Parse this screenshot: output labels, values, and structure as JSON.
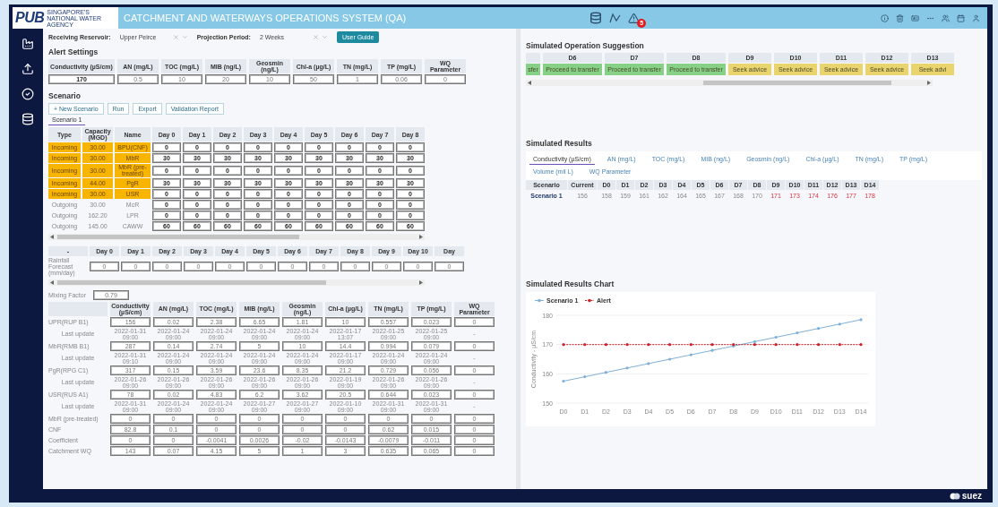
{
  "header": {
    "logo": "PUB",
    "logo_tagline": "SINGAPORE'S NATIONAL WATER AGENCY",
    "title": "CATCHMENT AND WATERWAYS OPERATIONS SYSTEM (QA)",
    "alert_badge": "5"
  },
  "filters": {
    "reservoir_label": "Receiving Reservoir:",
    "reservoir": "Upper Peirce",
    "period_label": "Projection Period:",
    "period": "2 Weeks",
    "guide_button": "User Guide"
  },
  "alert_settings": {
    "title": "Alert Settings",
    "columns": [
      "Conductivity (µS/cm)",
      "AN (mg/L)",
      "TOC (mg/L)",
      "MIB (ng/L)",
      "Geosmin (ng/L)",
      "Chl-a (µg/L)",
      "TN (mg/L)",
      "TP (mg/L)",
      "WQ Parameter"
    ],
    "values": [
      {
        "value": "170",
        "disabled": false
      },
      {
        "value": "0.5",
        "disabled": true
      },
      {
        "value": "10",
        "disabled": true
      },
      {
        "value": "20",
        "disabled": true
      },
      {
        "value": "10",
        "disabled": true
      },
      {
        "value": "50",
        "disabled": true
      },
      {
        "value": "1",
        "disabled": true
      },
      {
        "value": "0.06",
        "disabled": true
      },
      {
        "value": "0",
        "disabled": true
      }
    ]
  },
  "scenario": {
    "title": "Scenario",
    "buttons": [
      "+ New Scenario",
      "Run",
      "Export",
      "Validation Report"
    ],
    "tabs": [
      {
        "label": "Scenario 1",
        "selected": true
      }
    ],
    "columns": [
      "Type",
      "Capacity (MGD)",
      "Name",
      "Day 0",
      "Day 1",
      "Day 2",
      "Day 3",
      "Day 4",
      "Day 5",
      "Day 6",
      "Day 7",
      "Day 8"
    ],
    "rows": [
      {
        "type": "Incoming",
        "capacity": "30.00",
        "name": "BPU(CNF)",
        "highlighted": true,
        "days": [
          "0",
          "0",
          "0",
          "0",
          "0",
          "0",
          "0",
          "0",
          "0"
        ]
      },
      {
        "type": "Incoming",
        "capacity": "30.00",
        "name": "MbR",
        "highlighted": true,
        "days": [
          "30",
          "30",
          "30",
          "30",
          "30",
          "30",
          "30",
          "30",
          "30"
        ]
      },
      {
        "type": "Incoming",
        "capacity": "30.00",
        "name": "MbR (pre-treated)",
        "highlighted": true,
        "days": [
          "0",
          "0",
          "0",
          "0",
          "0",
          "0",
          "0",
          "0",
          "0"
        ]
      },
      {
        "type": "Incoming",
        "capacity": "44.00",
        "name": "PgR",
        "highlighted": true,
        "days": [
          "30",
          "30",
          "30",
          "30",
          "30",
          "30",
          "30",
          "30",
          "30"
        ]
      },
      {
        "type": "Incoming",
        "capacity": "30.00",
        "name": "USR",
        "highlighted": true,
        "days": [
          "0",
          "0",
          "0",
          "0",
          "0",
          "0",
          "0",
          "0",
          "0"
        ]
      },
      {
        "type": "Outgoing",
        "capacity": "30.00",
        "name": "McR",
        "highlighted": false,
        "days": [
          "0",
          "0",
          "0",
          "0",
          "0",
          "0",
          "0",
          "0",
          "0"
        ]
      },
      {
        "type": "Outgoing",
        "capacity": "162.20",
        "name": "LPR",
        "highlighted": false,
        "days": [
          "0",
          "0",
          "0",
          "0",
          "0",
          "0",
          "0",
          "0",
          "0"
        ]
      },
      {
        "type": "Outgoing",
        "capacity": "145.00",
        "name": "CAWW",
        "highlighted": false,
        "days": [
          "60",
          "60",
          "60",
          "60",
          "60",
          "60",
          "60",
          "60",
          "60"
        ]
      }
    ]
  },
  "rainfall": {
    "columns": [
      "-",
      "Day 0",
      "Day 1",
      "Day 2",
      "Day 3",
      "Day 4",
      "Day 5",
      "Day 6",
      "Day 7",
      "Day 8",
      "Day 9",
      "Day 10",
      "Day"
    ],
    "label": "Rainfall Forecast (mm/day)",
    "values": [
      "0",
      "0",
      "0",
      "0",
      "0",
      "0",
      "0",
      "0",
      "0",
      "0",
      "0",
      "0"
    ]
  },
  "mixing": {
    "label": "Mixing Factor",
    "value": "0.79"
  },
  "water_quality": {
    "columns": [
      "Conductivity (µS/cm)",
      "AN (mg/L)",
      "TOC (mg/L)",
      "MIB (ng/L)",
      "Geosmin (ng/L)",
      "Chl-a (µg/L)",
      "TN (mg/L)",
      "TP (mg/L)",
      "WQ Parameter"
    ],
    "rows": [
      {
        "label": "UPR(RUP B1)",
        "values": [
          "156",
          "0.02",
          "2.38",
          "6.65",
          "1.81",
          "10",
          "0.557",
          "0.023",
          "0"
        ],
        "last_update_label": "Last update",
        "updates": [
          "2022-01-31 09:00",
          "2022-01-24 09:00",
          "2022-01-24 09:00",
          "2022-01-24 09:00",
          "2022-01-24 09:00",
          "2022-01-17 13:07",
          "2022-01-25 09:00",
          "2022-01-25 09:00",
          "-"
        ]
      },
      {
        "label": "MbR(RMB B1)",
        "values": [
          "287",
          "0.14",
          "2.74",
          "5",
          "10",
          "14.4",
          "0.994",
          "0.079",
          "0"
        ],
        "last_update_label": "Last update",
        "updates": [
          "2022-01-31 09:10",
          "2022-01-24 09:00",
          "2022-01-24 09:00",
          "2022-01-24 09:00",
          "2022-01-24 09:00",
          "2022-01-17 09:00",
          "2022-01-24 09:00",
          "2022-01-24 09:00",
          "-"
        ]
      },
      {
        "label": "PgR(RPG C1)",
        "values": [
          "317",
          "0.15",
          "3.59",
          "23.6",
          "8.35",
          "21.2",
          "0.729",
          "0.056",
          "0"
        ],
        "last_update_label": "Last update",
        "updates": [
          "2022-01-26 09:00",
          "2022-01-26 09:00",
          "2022-01-26 09:00",
          "2022-01-26 09:00",
          "2022-01-26 09:00",
          "2022-01-19 09:00",
          "2022-01-26 09:00",
          "2022-01-26 09:00",
          "-"
        ]
      },
      {
        "label": "USR(RUS A1)",
        "values": [
          "78",
          "0.02",
          "4.83",
          "6.2",
          "3.62",
          "20.5",
          "0.644",
          "0.023",
          "0"
        ],
        "last_update_label": "Last update",
        "updates": [
          "2022-01-31 09:00",
          "2022-01-24 09:00",
          "2022-01-24 09:00",
          "2022-01-27 09:00",
          "2022-01-27 09:00",
          "2022-01-10 09:00",
          "2022-01-31 09:00",
          "2022-01-31 09:00",
          "-"
        ]
      },
      {
        "label": "MbR (pre-treated)",
        "values": [
          "0",
          "0",
          "0",
          "0",
          "0",
          "0",
          "0",
          "0",
          "0"
        ]
      },
      {
        "label": "CNF",
        "values": [
          "82.8",
          "0.1",
          "0",
          "0",
          "0",
          "0",
          "0.62",
          "0.015",
          "0"
        ]
      },
      {
        "label": "Coefficient",
        "values": [
          "0",
          "0",
          "-0.0041",
          "0.0026",
          "-0.02",
          "-0.0143",
          "-0.0079",
          "-0.011",
          "0"
        ]
      },
      {
        "label": "Catchment WQ",
        "values": [
          "143",
          "0.07",
          "4.15",
          "5",
          "1",
          "3",
          "0.635",
          "0.065",
          "0"
        ]
      }
    ]
  },
  "suggestion": {
    "title": "Simulated Operation Suggestion",
    "cells": [
      {
        "text": "sfer",
        "kind": "proceed"
      },
      {
        "day": "D6",
        "text": "Proceed to transfer",
        "kind": "proceed"
      },
      {
        "day": "D7",
        "text": "Proceed to transfer",
        "kind": "proceed"
      },
      {
        "day": "D8",
        "text": "Proceed to transfer",
        "kind": "proceed"
      },
      {
        "day": "D9",
        "text": "Seek advice",
        "kind": "advice"
      },
      {
        "day": "D10",
        "text": "Seek advice",
        "kind": "advice"
      },
      {
        "day": "D11",
        "text": "Seek advice",
        "kind": "advice"
      },
      {
        "day": "D12",
        "text": "Seek advice",
        "kind": "advice"
      },
      {
        "day": "D13",
        "text": "Seek advi",
        "kind": "advice"
      }
    ]
  },
  "results": {
    "title": "Simulated Results",
    "tabs": [
      {
        "label": "Conductivity (µS/cm)",
        "selected": true
      },
      {
        "label": "AN (mg/L)",
        "selected": false
      },
      {
        "label": "TOC (mg/L)",
        "selected": false
      },
      {
        "label": "MIB (ng/L)",
        "selected": false
      },
      {
        "label": "Geosmin (ng/L)",
        "selected": false
      },
      {
        "label": "Chl-a (µg/L)",
        "selected": false
      },
      {
        "label": "TN (mg/L)",
        "selected": false
      },
      {
        "label": "TP (mg/L)",
        "selected": false
      },
      {
        "label": "Volume (mil L)",
        "selected": false
      },
      {
        "label": "WQ Parameter",
        "selected": false
      }
    ],
    "columns": [
      "Scenario",
      "Current",
      "D0",
      "D1",
      "D2",
      "D3",
      "D4",
      "D5",
      "D6",
      "D7",
      "D8",
      "D9",
      "D10",
      "D11",
      "D12",
      "D13",
      "D14"
    ],
    "rows": [
      {
        "cells": [
          {
            "value": "Scenario 1",
            "alert": false
          },
          {
            "value": "156",
            "alert": false
          },
          {
            "value": "158",
            "alert": false
          },
          {
            "value": "159",
            "alert": false
          },
          {
            "value": "161",
            "alert": false
          },
          {
            "value": "162",
            "alert": false
          },
          {
            "value": "164",
            "alert": false
          },
          {
            "value": "165",
            "alert": false
          },
          {
            "value": "167",
            "alert": false
          },
          {
            "value": "168",
            "alert": false
          },
          {
            "value": "170",
            "alert": false
          },
          {
            "value": "171",
            "alert": true
          },
          {
            "value": "173",
            "alert": true
          },
          {
            "value": "174",
            "alert": true
          },
          {
            "value": "176",
            "alert": true
          },
          {
            "value": "177",
            "alert": true
          },
          {
            "value": "178",
            "alert": true
          }
        ]
      }
    ]
  },
  "chart": {
    "title": "Simulated Results Chart",
    "chart_data": {
      "type": "line",
      "legend": "top",
      "ylabel": "Conductivity - µS/cm",
      "x": [
        "D0",
        "D1",
        "D2",
        "D3",
        "D4",
        "D5",
        "D6",
        "D7",
        "D8",
        "D9",
        "D10",
        "D11",
        "D12",
        "D13",
        "D14"
      ],
      "ylim": [
        150,
        180
      ],
      "yticks": [
        150,
        160,
        170,
        180
      ],
      "series": [
        {
          "name": "Scenario 1",
          "color": "#7fb0d8",
          "line_style": "solid",
          "values": [
            157.5,
            159,
            160.5,
            162,
            163.5,
            165,
            166.5,
            168,
            169.5,
            171,
            172.5,
            174,
            175.5,
            177,
            178.5
          ]
        },
        {
          "name": "Alert",
          "color": "#d0202a",
          "line_style": "dashed",
          "values": [
            170,
            170,
            170,
            170,
            170,
            170,
            170,
            170,
            170,
            170,
            170,
            170,
            170,
            170,
            170
          ]
        }
      ]
    }
  },
  "footer": {
    "logo": "suez"
  }
}
